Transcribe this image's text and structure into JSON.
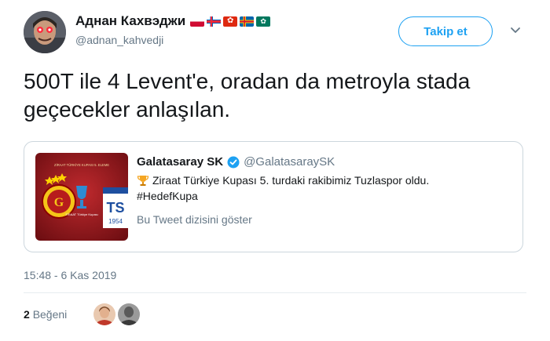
{
  "author": {
    "display_name": "Аднан Кахвэджи",
    "handle": "@adnan_kahvedji",
    "flags": [
      "greenland-flag",
      "faroe-islands-flag",
      "hong-kong-flag",
      "aland-flag",
      "macau-flag"
    ]
  },
  "follow_button_label": "Takip et",
  "tweet": {
    "text": "500T ile 4 Levent'e, oradan da metroyla stada geçecekler anlaşılan."
  },
  "quoted": {
    "name": "Galatasaray SK",
    "handle": "@GalatasaraySK",
    "body": "Ziraat Türkiye Kupası 5. turdaki rakibimiz Tuzlaspor oldu.",
    "hashtag": "#HedefKupa",
    "thread_link": "Bu Tweet dizisini göster",
    "image": {
      "caption": "ZİRAAT TÜRKİYE KUPASI 5. ELEME",
      "cup_label": "ZİRAAT Türkiye Kupası",
      "badge_text": "TS",
      "badge_year": "1954"
    }
  },
  "timestamp": "15:48 - 6 Kas 2019",
  "likes": {
    "count": "2",
    "label": "Beğeni"
  },
  "colors": {
    "accent": "#1da1f2",
    "secondary_text": "#657786",
    "border": "#ccd6dd",
    "galatasaray_red": "#a81a1f"
  }
}
